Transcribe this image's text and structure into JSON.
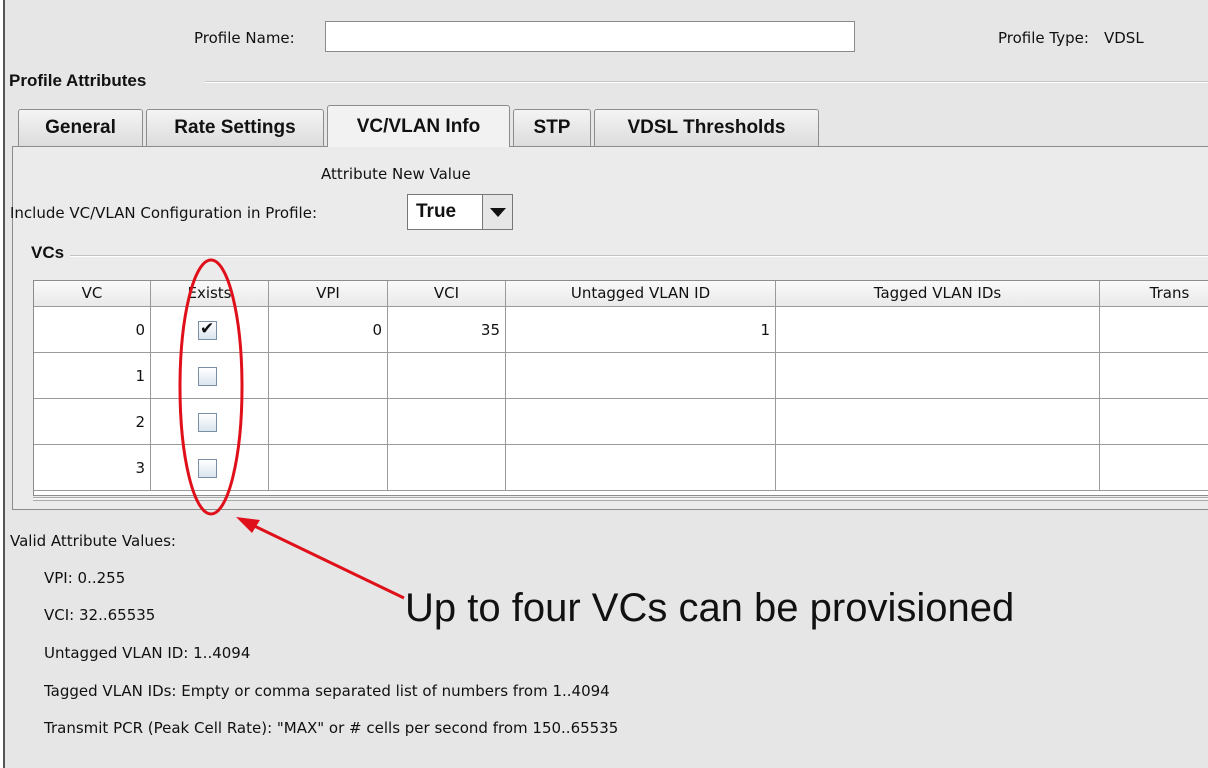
{
  "header": {
    "profile_name_label": "Profile Name:",
    "profile_name_value": "",
    "profile_type_label": "Profile Type:",
    "profile_type_value": "VDSL",
    "section_title": "Profile Attributes"
  },
  "tabs": [
    {
      "label": "General",
      "active": false
    },
    {
      "label": "Rate Settings",
      "active": false
    },
    {
      "label": "VC/VLAN Info",
      "active": true
    },
    {
      "label": "STP",
      "active": false
    },
    {
      "label": "VDSL Thresholds",
      "active": false
    }
  ],
  "config": {
    "column_header": "Attribute New Value",
    "include_label": "Include VC/VLAN Configuration in Profile:",
    "include_value": "True"
  },
  "vcs": {
    "title": "VCs",
    "columns": [
      "VC",
      "Exists",
      "VPI",
      "VCI",
      "Untagged VLAN ID",
      "Tagged VLAN IDs",
      "Trans"
    ],
    "rows": [
      {
        "vc": "0",
        "exists": true,
        "vpi": "0",
        "vci": "35",
        "untagged": "1",
        "tagged": "",
        "trans": ""
      },
      {
        "vc": "1",
        "exists": false,
        "vpi": "",
        "vci": "",
        "untagged": "",
        "tagged": "",
        "trans": ""
      },
      {
        "vc": "2",
        "exists": false,
        "vpi": "",
        "vci": "",
        "untagged": "",
        "tagged": "",
        "trans": ""
      },
      {
        "vc": "3",
        "exists": false,
        "vpi": "",
        "vci": "",
        "untagged": "",
        "tagged": "",
        "trans": ""
      }
    ]
  },
  "valid": {
    "title": "Valid Attribute Values:",
    "lines": [
      "VPI: 0..255",
      "VCI: 32..65535",
      "Untagged VLAN ID: 1..4094",
      "Tagged VLAN IDs: Empty or comma separated list of numbers from 1..4094",
      "Transmit PCR (Peak Cell Rate): \"MAX\" or # cells per second from 150..65535"
    ]
  },
  "annotation": {
    "text": "Up to four VCs can be provisioned",
    "color": "#e0101a"
  }
}
